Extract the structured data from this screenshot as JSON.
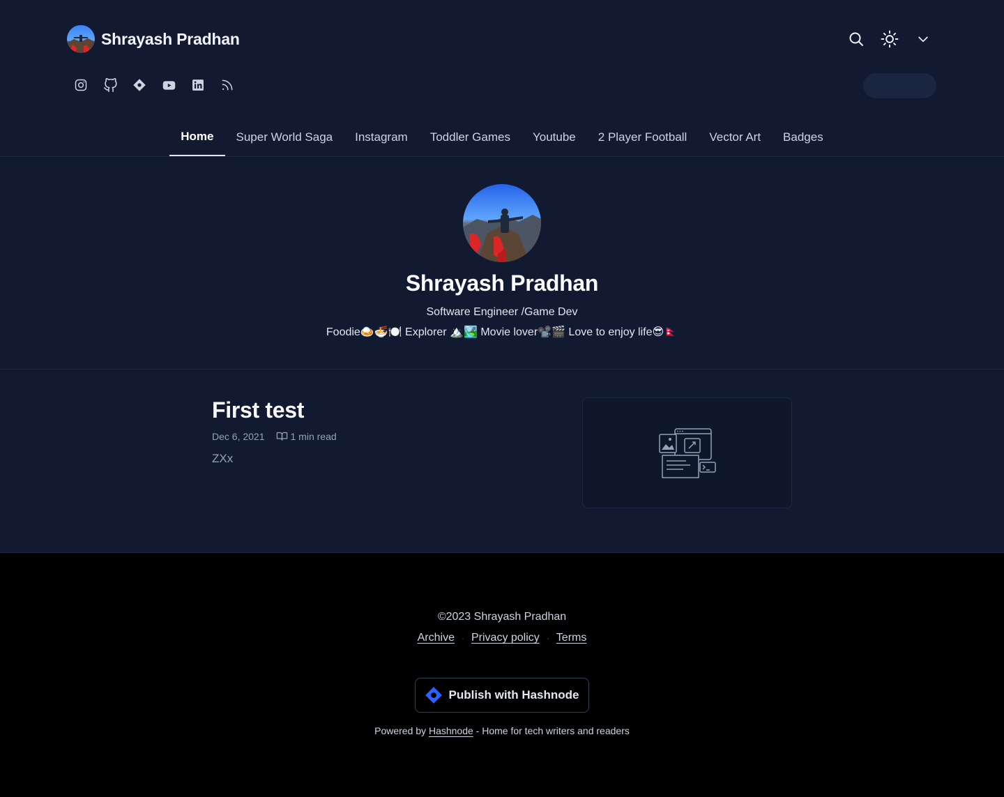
{
  "header": {
    "blog_name": "Shrayash Pradhan"
  },
  "social_links": [
    {
      "icon": "instagram-icon"
    },
    {
      "icon": "github-icon"
    },
    {
      "icon": "hashnode-icon"
    },
    {
      "icon": "youtube-icon"
    },
    {
      "icon": "linkedin-icon"
    },
    {
      "icon": "rss-icon"
    }
  ],
  "nav": {
    "items": [
      {
        "label": "Home",
        "active": true
      },
      {
        "label": "Super World Saga"
      },
      {
        "label": "Instagram"
      },
      {
        "label": "Toddler Games"
      },
      {
        "label": "Youtube"
      },
      {
        "label": "2 Player Football"
      },
      {
        "label": "Vector Art"
      },
      {
        "label": "Badges"
      }
    ]
  },
  "profile": {
    "name": "Shrayash Pradhan",
    "role": "Software Engineer /Game Dev",
    "bio": "Foodie🍛🍜🍽️ Explorer 🏔️🏞️ Movie lover📽️🎬 Love to enjoy life😎🇳🇵"
  },
  "posts": [
    {
      "title": "First test",
      "date": "Dec 6, 2021",
      "read_time": "1 min read",
      "excerpt": "ZXx"
    }
  ],
  "footer": {
    "copyright": "©2023 Shrayash Pradhan",
    "links": {
      "archive": "Archive",
      "privacy": "Privacy policy",
      "terms": "Terms"
    },
    "publish_label": "Publish with Hashnode",
    "powered_prefix": "Powered by",
    "powered_link": "Hashnode",
    "powered_suffix": "- Home for tech writers and readers"
  },
  "colors": {
    "background": "#111a30",
    "footer_background": "#000000",
    "hashnode_blue": "#2962ff"
  }
}
